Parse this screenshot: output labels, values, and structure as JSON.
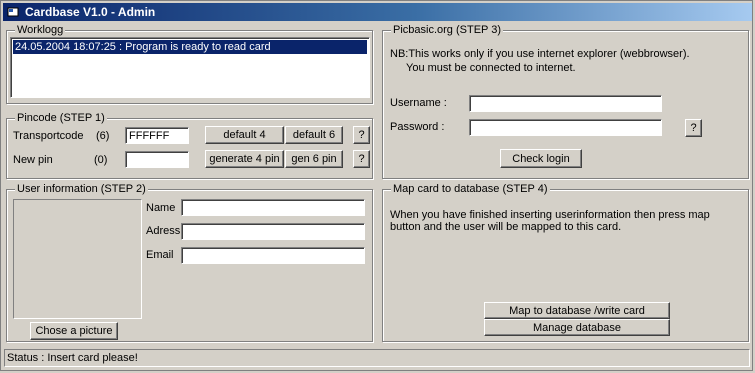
{
  "window": {
    "title": "Cardbase V1.0 - Admin",
    "icon": "app-icon"
  },
  "worklog": {
    "legend": "Worklogg",
    "items": [
      "24.05.2004 18:07:25 : Program is ready to read card"
    ]
  },
  "pincode": {
    "legend": "Pincode (STEP 1)",
    "transport_label": "Transportcode",
    "transport_count": "(6)",
    "transport_value": "FFFFFF",
    "newpin_label": "New pin",
    "newpin_count": "(0)",
    "newpin_value": "",
    "default4": "default 4",
    "default6": "default 6",
    "help": "?",
    "generate4": "generate 4 pin",
    "gen6": "gen 6 pin"
  },
  "user": {
    "legend": "User information (STEP 2)",
    "name_label": "Name",
    "adress_label": "Adress",
    "email_label": "Email",
    "name_value": "",
    "adress_value": "",
    "email_value": "",
    "choose_picture": "Chose a picture"
  },
  "picbasic": {
    "legend": "Picbasic.org (STEP 3)",
    "note_line1": "NB:This works only if you use internet explorer (webbrowser).",
    "note_line2": "You must be connected to internet.",
    "username_label": "Username :",
    "password_label": "Password :",
    "username_value": "",
    "password_value": "",
    "help": "?",
    "check_login": "Check login"
  },
  "mapcard": {
    "legend": "Map card to database (STEP 4)",
    "desc_line1": "When you have finished inserting userinformation then press map",
    "desc_line2": "button and the user will be mapped to this card.",
    "map_button": "Map to database /write card",
    "manage_button": "Manage database"
  },
  "status": {
    "text": "Status : Insert card please!"
  }
}
